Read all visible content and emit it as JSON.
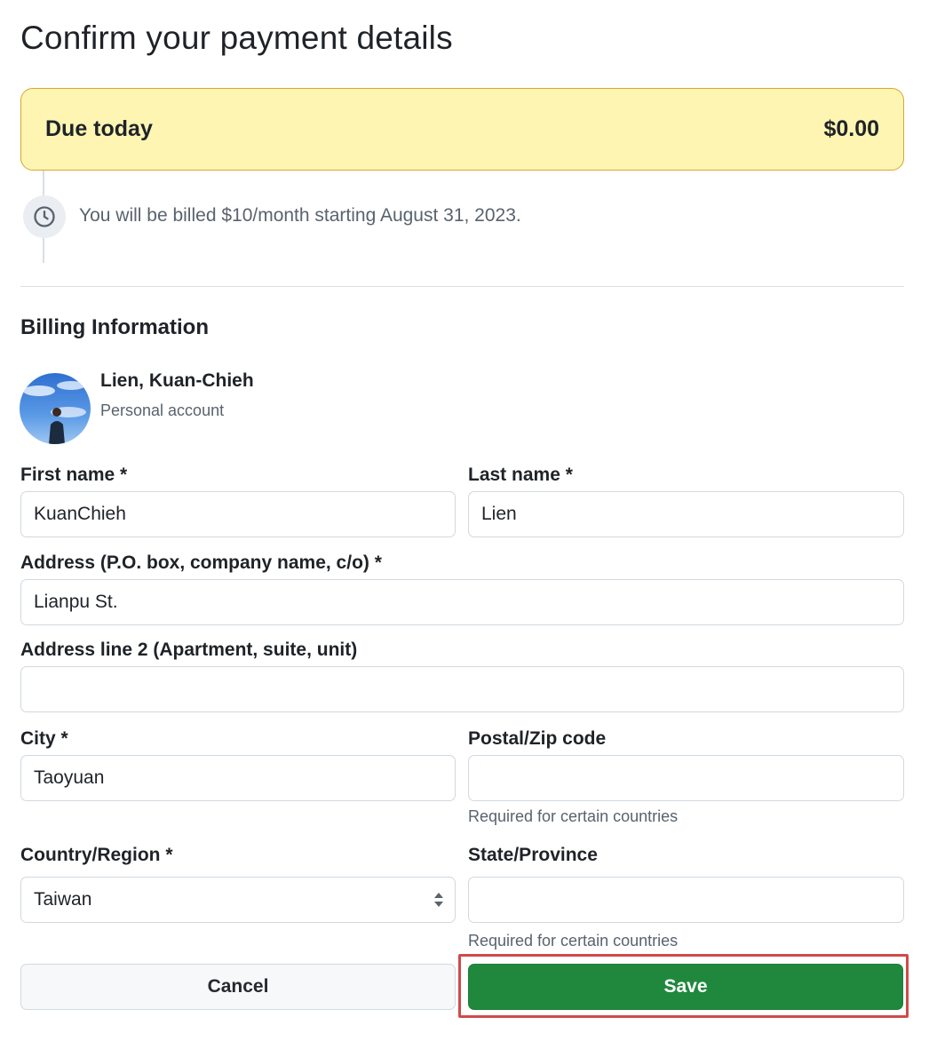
{
  "page": {
    "title": "Confirm your payment details"
  },
  "due": {
    "label": "Due today",
    "amount": "$0.00"
  },
  "billing_note": {
    "icon": "clock-icon",
    "text": "You will be billed $10/month starting August 31, 2023."
  },
  "billing": {
    "title": "Billing Information",
    "account": {
      "name": "Lien, Kuan-Chieh",
      "type": "Personal account",
      "avatar_icon": "avatar"
    }
  },
  "form": {
    "first_name": {
      "label": "First name *",
      "value": "KuanChieh"
    },
    "last_name": {
      "label": "Last name *",
      "value": "Lien"
    },
    "address": {
      "label": "Address (P.O. box, company name, c/o) *",
      "value": "Lianpu St."
    },
    "address2": {
      "label": "Address line 2 (Apartment, suite, unit)",
      "value": ""
    },
    "city": {
      "label": "City *",
      "value": "Taoyuan"
    },
    "postal": {
      "label": "Postal/Zip code",
      "value": "",
      "hint": "Required for certain countries"
    },
    "country": {
      "label": "Country/Region *",
      "value": "Taiwan"
    },
    "state": {
      "label": "State/Province",
      "value": "",
      "hint": "Required for certain countries"
    }
  },
  "actions": {
    "cancel_label": "Cancel",
    "save_label": "Save"
  },
  "colors": {
    "due_background": "#fff5b3",
    "due_border": "#d4a72c",
    "save_button": "#1f883d",
    "highlight": "#cf4b4b"
  }
}
